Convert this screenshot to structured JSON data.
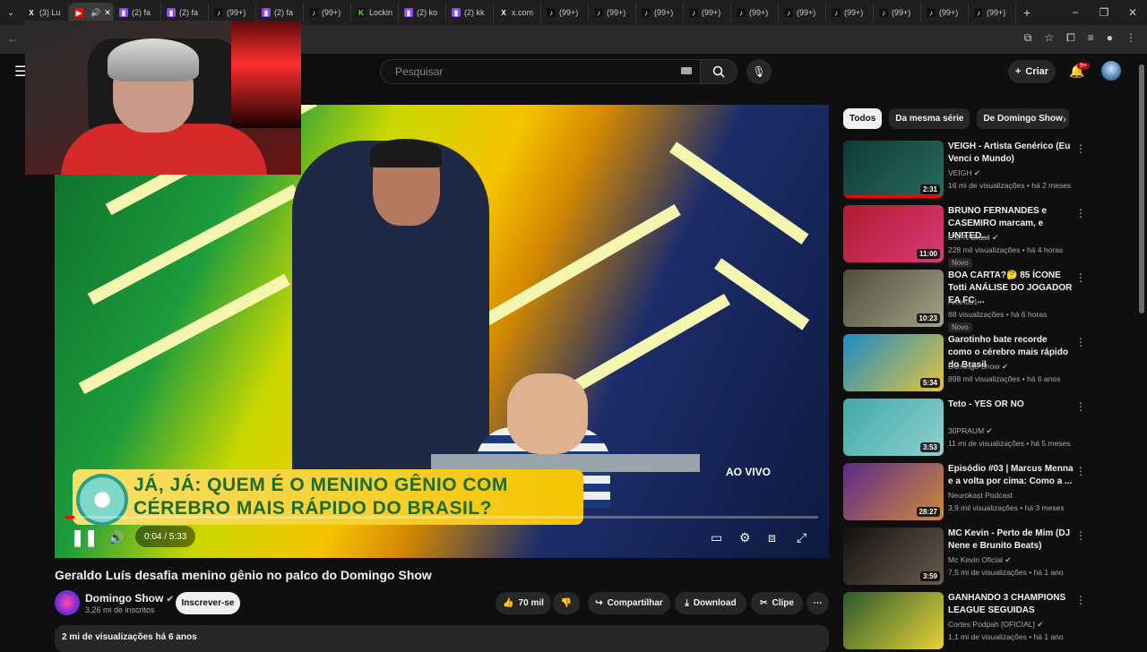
{
  "browser": {
    "tabs": [
      {
        "icon": "x-icon",
        "label": "(3) Lu"
      },
      {
        "icon": "youtube-icon",
        "label": ""
      },
      {
        "icon": "twitch-icon",
        "label": "(2) fa"
      },
      {
        "icon": "twitch-icon",
        "label": "(2) fa"
      },
      {
        "icon": "tiktok-icon",
        "label": "(99+)"
      },
      {
        "icon": "twitch-icon",
        "label": "(2) fa"
      },
      {
        "icon": "tiktok-icon",
        "label": "(99+)"
      },
      {
        "icon": "kick-icon",
        "label": "Lockin"
      },
      {
        "icon": "twitch-icon",
        "label": "(2) ko"
      },
      {
        "icon": "twitch-icon",
        "label": "(2) kk"
      },
      {
        "icon": "x-icon",
        "label": "x.com"
      },
      {
        "icon": "tiktok-icon",
        "label": "(99+)"
      },
      {
        "icon": "tiktok-icon",
        "label": "(99+)"
      },
      {
        "icon": "tiktok-icon",
        "label": "(99+)"
      },
      {
        "icon": "tiktok-icon",
        "label": "(99+)"
      },
      {
        "icon": "tiktok-icon",
        "label": "(99+)"
      },
      {
        "icon": "tiktok-icon",
        "label": "(99+)"
      },
      {
        "icon": "tiktok-icon",
        "label": "(99+)"
      },
      {
        "icon": "tiktok-icon",
        "label": "(99+)"
      },
      {
        "icon": "tiktok-icon",
        "label": "(99+)"
      },
      {
        "icon": "tiktok-icon",
        "label": "(99+)"
      }
    ],
    "new_tab": "+",
    "window_controls": [
      "−",
      "❐",
      "✕"
    ]
  },
  "header": {
    "search_placeholder": "Pesquisar",
    "create_label": "Criar",
    "notifications_badge": "9+"
  },
  "video": {
    "banner_line1": "JÁ, JÁ: QUEM É O MENINO GÊNIO COM",
    "banner_line2": "CÉREBRO MAIS RÁPIDO DO BRASIL?",
    "live_tag": "AO VIVO",
    "time": "0:04 / 5:33",
    "progress": 0.012
  },
  "info": {
    "title": "Geraldo Luís desafia menino gênio no palco do Domingo Show",
    "channel": "Domingo Show",
    "subscribers": "3,26 mi de inscritos",
    "subscribe_label": "Inscrever-se",
    "likes": "70 mil",
    "share_label": "Compartilhar",
    "download_label": "Download",
    "clip_label": "Clipe",
    "views_line": "2 mi de visualizações  há 6 anos"
  },
  "chips": [
    "Todos",
    "Da mesma série",
    "De Domingo Show"
  ],
  "recommendations": [
    {
      "title": "VEIGH - Artista Genérico (Eu Venci o Mundo)",
      "channel": "VEIGH",
      "meta": "16 mi de visualizações • há 2 meses",
      "duration": "2:31",
      "badge": "",
      "verified": true,
      "colors": [
        "#0d3a3a",
        "#2b6b5c"
      ]
    },
    {
      "title": "BRUNO FERNANDES e CASEMIRO marcam, e UNITED...",
      "channel": "ESPN Brasil",
      "meta": "228 mil visualizações • há 4 horas",
      "duration": "11:00",
      "badge": "Novo",
      "verified": true,
      "colors": [
        "#b01c2c",
        "#d93a7a"
      ]
    },
    {
      "title": "BOA CARTA?🤔 85 ÍCONE Totti ANÁLISE DO JOGADOR EA FC ...",
      "channel": "Aminus1",
      "meta": "88 visualizações • há 6 horas",
      "duration": "10:23",
      "badge": "Novo",
      "verified": false,
      "colors": [
        "#4d4d3a",
        "#a3a38a"
      ]
    },
    {
      "title": "Garotinho bate recorde como o cérebro mais rápido do Brasil",
      "channel": "Domingo Show",
      "meta": "898 mil visualizações • há 6 anos",
      "duration": "5:34",
      "badge": "",
      "verified": true,
      "colors": [
        "#1a8cc9",
        "#e6c23a"
      ]
    },
    {
      "title": "Teto - YES OR NO",
      "channel": "30PRAUM",
      "meta": "11 mi de visualizações • há 5 meses",
      "duration": "3:53",
      "badge": "",
      "verified": true,
      "colors": [
        "#3fa9a9",
        "#8fd1cf"
      ]
    },
    {
      "title": "Episódio #03 | Marcus Menna e a volta por cima: Como a ...",
      "channel": "Neurokast Podcast",
      "meta": "3,9 mil visualizações • há 3 meses",
      "duration": "28:27",
      "badge": "",
      "verified": false,
      "colors": [
        "#5a2a8a",
        "#d08a3a"
      ]
    },
    {
      "title": "MC Kevin - Perto de Mim (DJ Nene e Brunito Beats)",
      "channel": "Mc Kevin Oficial",
      "meta": "7,5 mi de visualizações • há 1 ano",
      "duration": "3:59",
      "badge": "",
      "verified": true,
      "colors": [
        "#111111",
        "#6b5a4a"
      ]
    },
    {
      "title": "GANHANDO 3 CHAMPIONS LEAGUE SEGUIDAS",
      "channel": "Cortes Podpah [OFICIAL]",
      "meta": "1,1 mi de visualizações • há 1 ano",
      "duration": "",
      "badge": "",
      "verified": true,
      "colors": [
        "#2a5a2a",
        "#e8d23a"
      ]
    }
  ]
}
